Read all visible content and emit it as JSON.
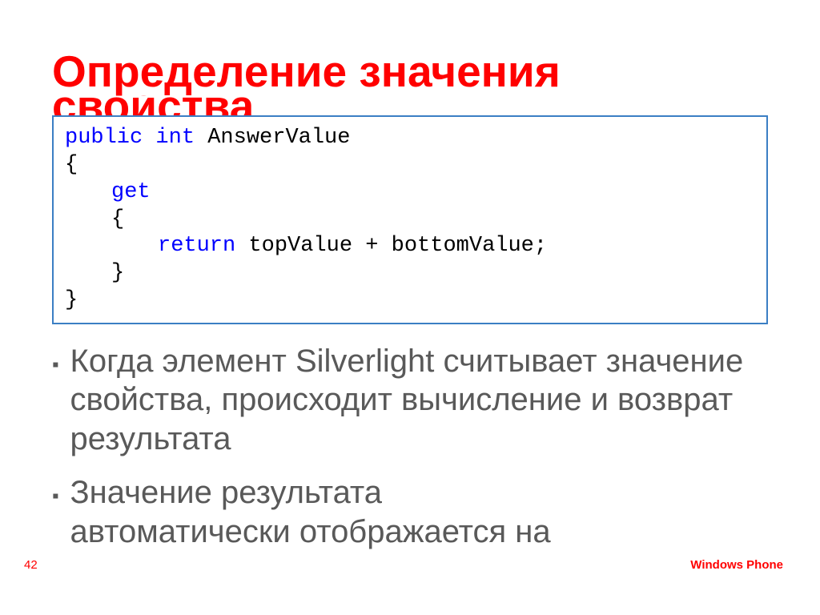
{
  "title_line1": "Определение значения",
  "title_line2_cut": "свойства",
  "code": {
    "l1_kw1": "public",
    "l1_kw2": "int",
    "l1_rest": " AnswerValue",
    "l2": "{",
    "l3_kw": "get",
    "l4": "{",
    "l5_kw": "return",
    "l5_rest": " topValue + bottomValue;",
    "l6": "}",
    "l7": "}"
  },
  "bullets": {
    "b1": "Когда элемент Silverlight считывает значение свойства, происходит вычисление и возврат результата",
    "b2": "Значение результата",
    "b2_cut": "автоматически отображается на"
  },
  "page_number": "42",
  "footer": "Windows Phone"
}
